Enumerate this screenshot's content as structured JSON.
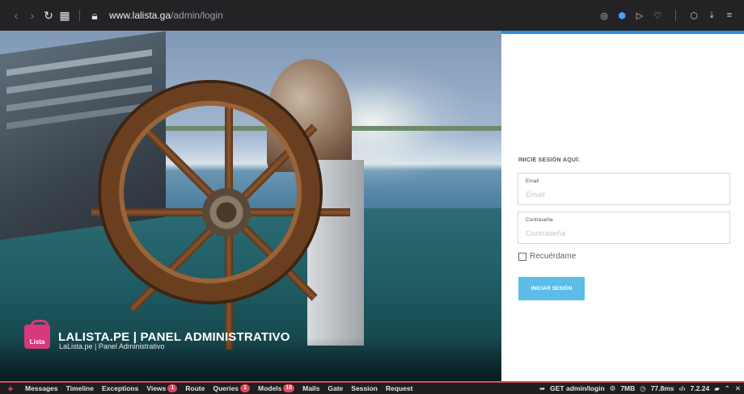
{
  "browser": {
    "url_host": "www.lalista.ga",
    "url_path": "/admin/login",
    "icons": [
      "camera-icon",
      "shield-icon",
      "play-icon",
      "heart-icon",
      "cube-icon",
      "download-icon",
      "menu-icon"
    ]
  },
  "brand": {
    "logo_text": "Lista",
    "title": "LALISTA.PE | PANEL ADMINISTRATIVO",
    "subtitle": "LaLista.pe | Panel Administrativo"
  },
  "login": {
    "heading": "INICIE SESIÓN AQUÍ:",
    "email_label": "Email",
    "email_placeholder": "Email",
    "password_label": "Contraseña",
    "password_placeholder": "Contraseña",
    "remember_label": "Recuérdame",
    "submit_label": "INICIAR SESIÓN",
    "accent_color": "#2c8be0",
    "button_color": "#5cbde8"
  },
  "debugbar": {
    "tabs": [
      {
        "label": "Messages",
        "badge": ""
      },
      {
        "label": "Timeline",
        "badge": ""
      },
      {
        "label": "Exceptions",
        "badge": ""
      },
      {
        "label": "Views",
        "badge": "1"
      },
      {
        "label": "Route",
        "badge": ""
      },
      {
        "label": "Queries",
        "badge": "1"
      },
      {
        "label": "Models",
        "badge": "10"
      },
      {
        "label": "Mails",
        "badge": ""
      },
      {
        "label": "Gate",
        "badge": ""
      },
      {
        "label": "Session",
        "badge": ""
      },
      {
        "label": "Request",
        "badge": ""
      }
    ],
    "request": "GET admin/login",
    "memory": "7MB",
    "time": "77.8ms",
    "php_version": "7.2.24",
    "accent": "#e0485c"
  }
}
